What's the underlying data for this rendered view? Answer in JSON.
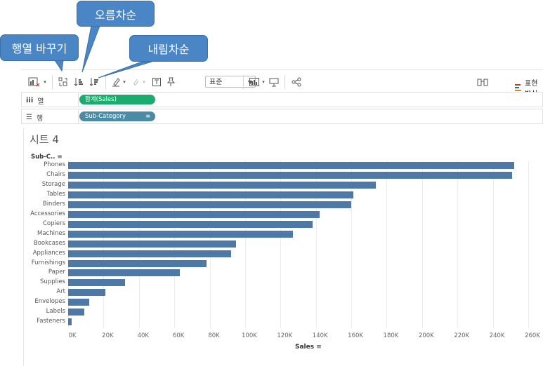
{
  "callouts": {
    "swap": "행열 바꾸기",
    "ascending": "오름차순",
    "descending": "내림차순"
  },
  "toolbar": {
    "format_select": "표준",
    "show_me": "표현 방식"
  },
  "shelves": {
    "columns_label": "열",
    "columns_pill": "합계(Sales)",
    "rows_label": "행",
    "rows_pill": "Sub-Category"
  },
  "sheet": {
    "title": "시트 4",
    "row_header": "Sub-C.."
  },
  "colors": {
    "bar": "#4e79a7",
    "green_pill": "#1bab6e",
    "teal_pill": "#4b8ba3",
    "callout": "#4a86c5"
  },
  "chart_data": {
    "type": "bar",
    "orientation": "horizontal",
    "categories": [
      "Phones",
      "Chairs",
      "Storage",
      "Tables",
      "Binders",
      "Accessories",
      "Copiers",
      "Machines",
      "Bookcases",
      "Appliances",
      "Furnishings",
      "Paper",
      "Supplies",
      "Art",
      "Envelopes",
      "Labels",
      "Fasteners"
    ],
    "values": [
      252000,
      251000,
      174000,
      161000,
      160000,
      142000,
      138000,
      127000,
      95000,
      92000,
      78000,
      63000,
      32000,
      21000,
      12000,
      9000,
      2000
    ],
    "xlabel": "Sales",
    "ylabel": "Sub-C..",
    "xlim": [
      0,
      260000
    ],
    "ticks": [
      "0K",
      "20K",
      "40K",
      "60K",
      "80K",
      "100K",
      "120K",
      "140K",
      "160K",
      "180K",
      "200K",
      "220K",
      "240K",
      "260K"
    ],
    "grid": true
  }
}
